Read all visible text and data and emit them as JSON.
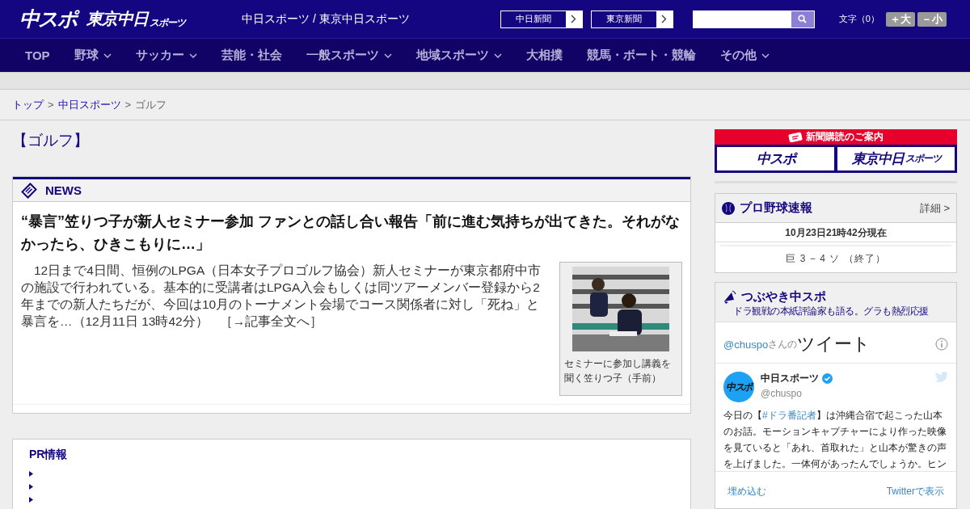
{
  "header": {
    "logo_main": "中スポ",
    "logo_tokyo": "東京中日",
    "logo_tokyo_sub": "スポーツ",
    "site_title": "中日スポーツ / 東京中日スポーツ",
    "paper_links": [
      "中日新聞",
      "東京新聞"
    ],
    "font_label": "文字（0）",
    "font_buttons": [
      "＋大",
      "－小"
    ]
  },
  "nav": [
    {
      "label": "TOP",
      "dropdown": false
    },
    {
      "label": "野球",
      "dropdown": true
    },
    {
      "label": "サッカー",
      "dropdown": true
    },
    {
      "label": "芸能・社会",
      "dropdown": false
    },
    {
      "label": "一般スポーツ",
      "dropdown": true
    },
    {
      "label": "地域スポーツ",
      "dropdown": true
    },
    {
      "label": "大相撲",
      "dropdown": false
    },
    {
      "label": "競馬・ボート・競輪",
      "dropdown": false
    },
    {
      "label": "その他",
      "dropdown": true
    }
  ],
  "breadcrumb": [
    {
      "label": "トップ",
      "link": true
    },
    {
      "separator": ">",
      "label": "中日スポーツ",
      "link": true
    },
    {
      "separator": ">",
      "label": "ゴルフ",
      "link": false
    }
  ],
  "page_title": "【ゴルフ】",
  "news": {
    "heading": "NEWS",
    "headline": "“暴言”笠りつ子が新人セミナー参加 ファンとの話し合い報告「前に進む気持ちが出てきた。それがなかったら、ひきこもりに…」",
    "body": "　12日まで4日間、恒例のLPGA（日本女子プロゴルフ協会）新人セミナーが東京都府中市の施設で行われている。基本的に受講者はLPGA入会もしくは同ツアーメンバー登録から2年までの新人たちだが、今回は10月のトーナメント会場でコース関係者に対し「死ね」と暴言を…（12月11日 13時42分）",
    "more": "［→記事全文へ］",
    "photo": {
      "kind": "picture",
      "caption": "セミナーに参加し講義を聞く笠りつ子（手前）"
    }
  },
  "pr": {
    "title": "PR情報",
    "items": [
      {
        "kind": "blank"
      },
      {
        "kind": "blank"
      },
      {
        "kind": "blank"
      }
    ]
  },
  "subscribe": {
    "title": "新聞購読のご案内",
    "papers": [
      {
        "kind": "chuspo",
        "label": "中スポ"
      },
      {
        "kind": "tokyo",
        "label": "東京中日",
        "sub": "スポーツ"
      }
    ]
  },
  "baseball": {
    "title": "プロ野球速報",
    "detail": "詳細 >",
    "timestamp": "10月23日21時42分現在",
    "games": [
      "巨 3 − 4 ソ （終了）"
    ]
  },
  "tsubuyaki": {
    "title": "つぶやき中スポ",
    "subtitle": "ドラ観戦の本紙評論家も語る。グラも熱烈応援"
  },
  "twitter": {
    "handle": "@chuspo",
    "handle_suffix": "さんの",
    "heading": "ツイート",
    "avatar_text": "中スポ",
    "name": "中日スポーツ",
    "verified": true,
    "user": "@chuspo",
    "text_before": "今日の【",
    "hashtag": "#ドラ番記者",
    "text_after": "】は沖縄合宿で起こった山本のお話。モーションキャプチャーにより作った映像を見ていると「あれ、首取れた」と山本が驚きの声を上げました。一体何があったんでしょうか。ヒン",
    "embed": "埋め込む",
    "view": "Twitterで表示"
  }
}
